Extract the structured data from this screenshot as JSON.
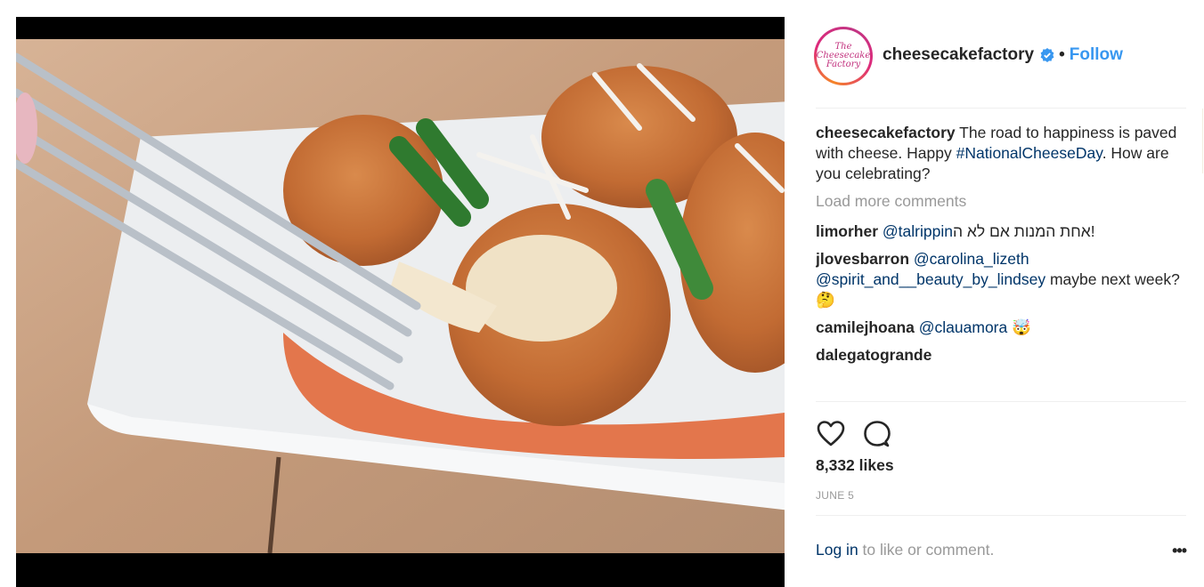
{
  "post": {
    "author": "cheesecakefactory",
    "avatar_logo_line1": "The",
    "avatar_logo_line2": "Cheesecake",
    "avatar_logo_line3": "Factory",
    "verified_icon": "verified-badge-icon",
    "separator": "•",
    "follow_label": "Follow",
    "caption": {
      "user": "cheesecakefactory",
      "text_before": " The road to happiness is paved with cheese. Happy ",
      "hashtag": "#NationalCheeseDay",
      "text_after": ". How are you celebrating?"
    },
    "load_more_label": "Load more comments",
    "comments": [
      {
        "user": "limorher",
        "mention": "@talrippin",
        "text": " !אחת המנות אם לא ה",
        "emoji": ""
      },
      {
        "user": "jlovesbarron",
        "mention": "@carolina_lizeth @spirit_and__beauty_by_lindsey",
        "text": " maybe next week? ",
        "emoji": "🤔"
      },
      {
        "user": "camilejhoana",
        "mention": "@clauamora",
        "text": " ",
        "emoji": "🤯"
      },
      {
        "user": "dalegatogrande",
        "mention": "",
        "text": "",
        "emoji": ""
      }
    ],
    "actions": {
      "like_icon": "heart-icon",
      "comment_icon": "comment-bubble-icon"
    },
    "likes_label": "8,332 likes",
    "date_label": "JUNE 5",
    "login_link": "Log in",
    "login_suffix": " to like or comment.",
    "more_label": "•••"
  },
  "colors": {
    "link": "#3897f0",
    "mention": "#003569",
    "muted": "#999999",
    "text": "#262626"
  }
}
